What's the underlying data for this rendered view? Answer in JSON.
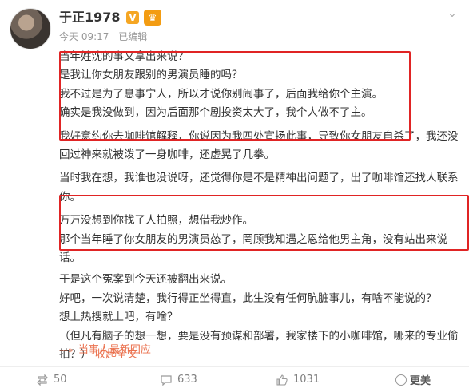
{
  "user": {
    "name": "于正1978",
    "verified_badge": "V",
    "vip_badge": "♛",
    "time": "今天 09:17",
    "edited": "已编辑"
  },
  "post": {
    "lines": [
      "当年姓沈的事又拿出来说？",
      "是我让你女朋友跟别的男演员睡的吗？",
      "我不过是为了息事宁人，所以才说你别闹事了，后面我给你个主演。",
      "确实是我没做到，因为后面那个剧投资太大了，我个人做不了主。",
      "我好意约你去咖啡馆解释，你说因为我四处宣扬此事，导致你女朋友自杀了，我还没回过神来就被泼了一身咖啡，还虚晃了几拳。",
      "当时我在想，我谁也没说呀，还觉得你是不是精神出问题了，出了咖啡馆还找人联系你。",
      "万万没想到你找了人拍照，想借我炒作。",
      "那个当年睡了你女朋友的男演员怂了，罔顾我知遇之恩给他男主角，没有站出来说话。",
      "于是这个冤案到今天还被翻出来说。",
      "好吧，一次说清楚，我行得正坐得直，此生没有任何肮脏事儿，有啥不能说的？",
      "想上热搜就上吧，有啥？",
      "（但凡有脑子的想一想，要是没有预谋和部署，我家楼下的小咖啡馆，哪来的专业偷拍？）"
    ],
    "read_more": "收起全文",
    "reply_link": "当事人最新回应"
  },
  "footer": {
    "repost_count": "50",
    "comment_count": "633",
    "like_count": "1031",
    "watermark": "更美"
  },
  "colors": {
    "highlight_box": "#e02424",
    "link": "#eb7350",
    "meta": "#999999"
  }
}
